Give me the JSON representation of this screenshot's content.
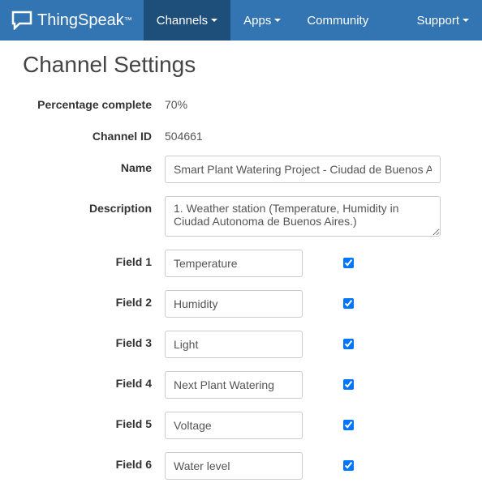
{
  "brand": {
    "name": "ThingSpeak",
    "tm": "™"
  },
  "nav": {
    "channels": "Channels",
    "apps": "Apps",
    "community": "Community",
    "support": "Support"
  },
  "page": {
    "title": "Channel Settings"
  },
  "labels": {
    "percentage": "Percentage complete",
    "channel_id": "Channel ID",
    "name": "Name",
    "description": "Description",
    "field1": "Field 1",
    "field2": "Field 2",
    "field3": "Field 3",
    "field4": "Field 4",
    "field5": "Field 5",
    "field6": "Field 6"
  },
  "values": {
    "percentage": "70%",
    "channel_id": "504661",
    "name": "Smart Plant Watering Project - Ciudad de Buenos Aires",
    "description": "1. Weather station (Temperature, Humidity in Ciudad Autonoma de Buenos Aires.)",
    "field1": "Temperature",
    "field2": "Humidity",
    "field3": "Light",
    "field4": "Next Plant Watering",
    "field5": "Voltage",
    "field6": "Water level"
  }
}
